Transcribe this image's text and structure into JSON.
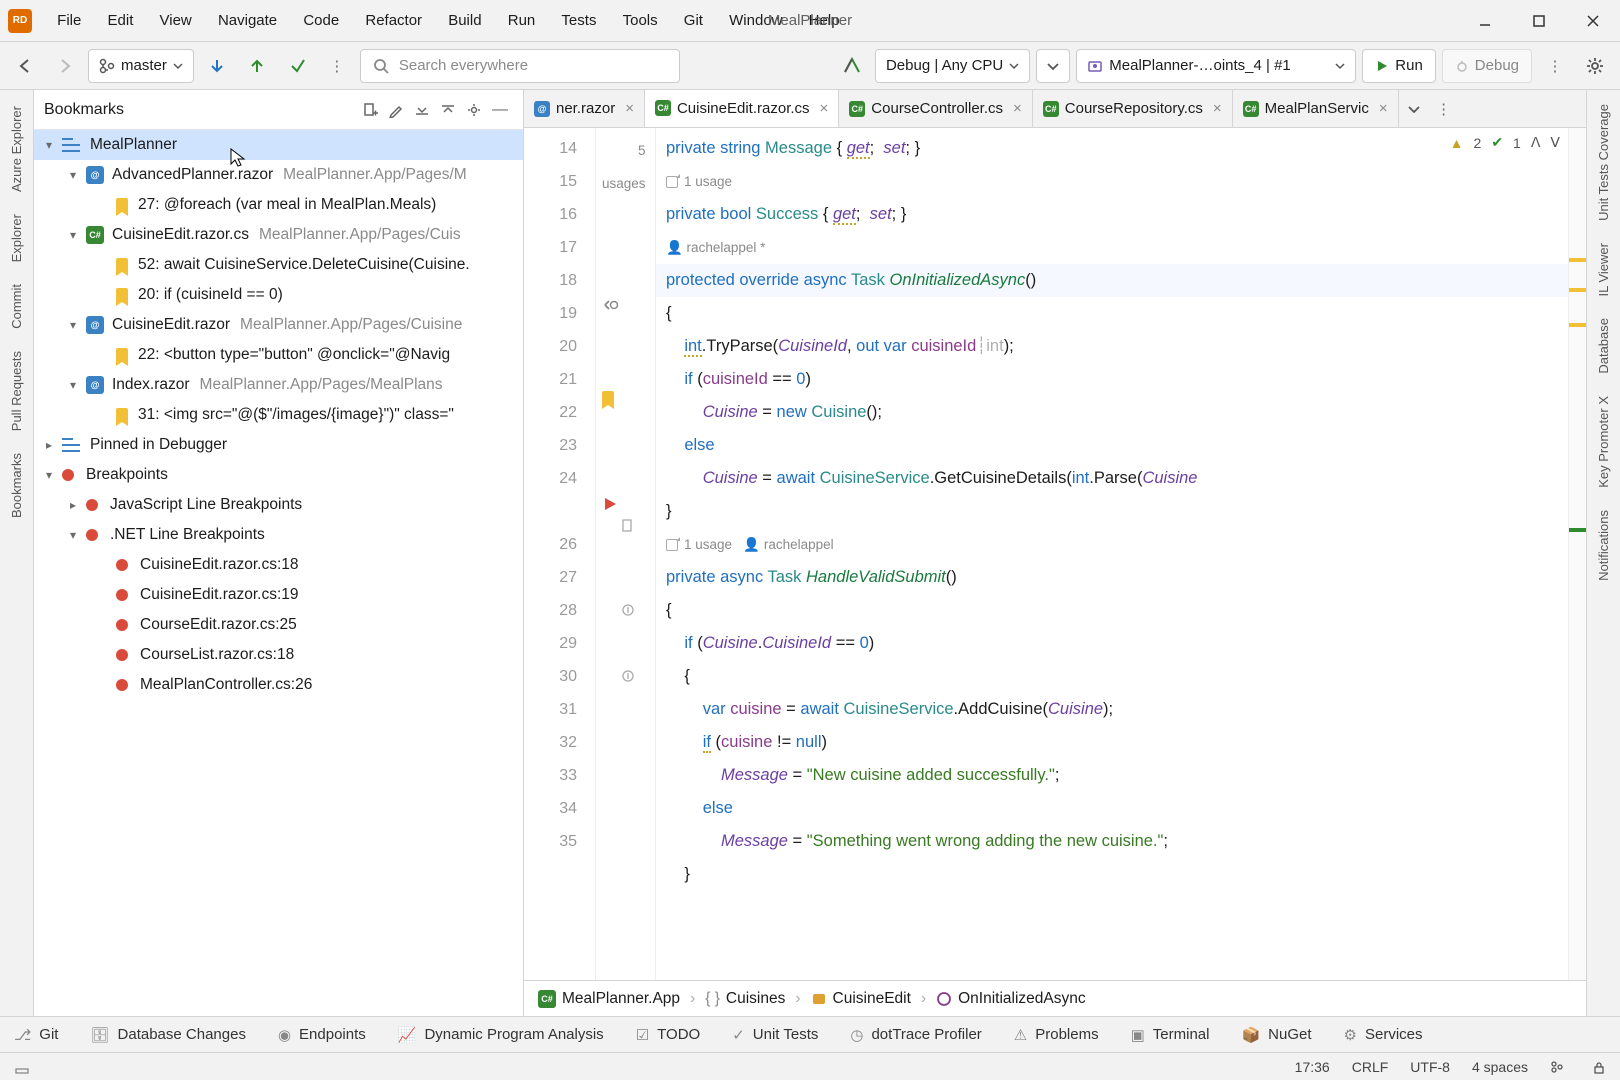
{
  "app": {
    "title": "MealPlanner"
  },
  "menu": [
    "File",
    "Edit",
    "View",
    "Navigate",
    "Code",
    "Refactor",
    "Build",
    "Run",
    "Tests",
    "Tools",
    "Git",
    "Window",
    "Help"
  ],
  "toolbar": {
    "branch": "master",
    "search_placeholder": "Search everywhere",
    "debug_cfg": "Debug | Any CPU",
    "run_cfg": "MealPlanner-…oints_4 | #1",
    "run_label": "Run",
    "debug_label": "Debug"
  },
  "left_rail": [
    "Azure Explorer",
    "Explorer",
    "Commit",
    "Pull Requests",
    "Bookmarks"
  ],
  "right_rail": [
    "Unit Tests Coverage",
    "IL Viewer",
    "Database",
    "Key Promoter X",
    "Notifications"
  ],
  "panel": {
    "title": "Bookmarks",
    "root": "MealPlanner",
    "files": [
      {
        "name": "AdvancedPlanner.razor",
        "path": "MealPlanner.App/Pages/M",
        "kind": "rz",
        "bm": [
          {
            "line": "27",
            "text": "@foreach (var meal in MealPlan.Meals)"
          }
        ]
      },
      {
        "name": "CuisineEdit.razor.cs",
        "path": "MealPlanner.App/Pages/Cuis",
        "kind": "cs",
        "bm": [
          {
            "line": "52",
            "text": "await CuisineService.DeleteCuisine(Cuisine."
          },
          {
            "line": "20",
            "text": "if (cuisineId == 0)"
          }
        ]
      },
      {
        "name": "CuisineEdit.razor",
        "path": "MealPlanner.App/Pages/Cuisine",
        "kind": "rz",
        "bm": [
          {
            "line": "22",
            "text": "<button type=\"button\" @onclick=\"@Navig"
          }
        ]
      },
      {
        "name": "Index.razor",
        "path": "MealPlanner.App/Pages/MealPlans",
        "kind": "rz",
        "bm": [
          {
            "line": "31",
            "text": "<img src=\"@($\"/images/{image}\")\" class=\""
          }
        ]
      }
    ],
    "pinned": "Pinned in Debugger",
    "breakpoints_label": "Breakpoints",
    "bp_groups": [
      {
        "name": "JavaScript Line Breakpoints",
        "expanded": false,
        "items": []
      },
      {
        "name": ".NET Line Breakpoints",
        "expanded": true,
        "items": [
          "CuisineEdit.razor.cs:18",
          "CuisineEdit.razor.cs:19",
          "CourseEdit.razor.cs:25",
          "CourseList.razor.cs:18",
          "MealPlanController.cs:26"
        ]
      }
    ]
  },
  "tabs": [
    {
      "label": "ner.razor",
      "kind": "rz",
      "active": false,
      "trunc": true
    },
    {
      "label": "CuisineEdit.razor.cs",
      "kind": "cs",
      "active": true
    },
    {
      "label": "CourseController.cs",
      "kind": "cs",
      "active": false
    },
    {
      "label": "CourseRepository.cs",
      "kind": "cs",
      "active": false
    },
    {
      "label": "MealPlanServic",
      "kind": "cs",
      "active": false,
      "trunc": true
    }
  ],
  "editor_status": {
    "warn": "2",
    "ok": "1"
  },
  "gutter_lines": [
    "14",
    "15",
    "16",
    "17",
    "18",
    "19",
    "20",
    "21",
    "22",
    "23",
    "24",
    "",
    "26",
    "27",
    "28",
    "29",
    "30",
    "31",
    "32",
    "33",
    "34",
    "35"
  ],
  "annotations": {
    "usages_top": "5 usages",
    "usage1": "1 usage",
    "author1": "rachelappel *",
    "usage2": "1 usage",
    "author2": "rachelappel"
  },
  "code_lines": [
    {
      "seg": [
        [
          "kw",
          "private "
        ],
        [
          "kw",
          "string "
        ],
        [
          "ty",
          "Message"
        ],
        [
          "",
          " { "
        ],
        [
          "prop under",
          "get"
        ],
        [
          "",
          ";  "
        ],
        [
          "prop",
          "set"
        ],
        [
          "",
          "; }"
        ]
      ]
    },
    {
      "usage": "usage1"
    },
    {
      "seg": [
        [
          "kw",
          "private "
        ],
        [
          "kw",
          "bool "
        ],
        [
          "ty",
          "Success"
        ],
        [
          "",
          " { "
        ],
        [
          "prop under",
          "get"
        ],
        [
          "",
          ";  "
        ],
        [
          "prop",
          "set"
        ],
        [
          "",
          "; }"
        ]
      ]
    },
    {
      "seg": [
        [
          "",
          ""
        ]
      ]
    },
    {
      "author": "author1"
    },
    {
      "seg": [
        [
          "kw",
          "protected override async "
        ],
        [
          "ty",
          "Task "
        ],
        [
          "fn",
          "OnInitializedAsync"
        ],
        [
          "",
          "()"
        ]
      ],
      "hl": true
    },
    {
      "seg": [
        [
          "",
          "{"
        ]
      ]
    },
    {
      "seg": [
        [
          "",
          "    "
        ],
        [
          "kw under",
          "int"
        ],
        [
          "",
          ".TryParse("
        ],
        [
          "prop",
          "CuisineId"
        ],
        [
          "",
          ", "
        ],
        [
          "kw",
          "out var "
        ],
        [
          "var",
          "cuisineId"
        ],
        [
          "hint",
          "┆int"
        ],
        [
          "",
          ");"
        ]
      ]
    },
    {
      "seg": [
        [
          "",
          "    "
        ],
        [
          "kw",
          "if "
        ],
        [
          "",
          "("
        ],
        [
          "var",
          "cuisineId"
        ],
        [
          "",
          " == "
        ],
        [
          "num",
          "0"
        ],
        [
          "",
          ")"
        ]
      ]
    },
    {
      "seg": [
        [
          "",
          "        "
        ],
        [
          "prop",
          "Cuisine"
        ],
        [
          "",
          " = "
        ],
        [
          "kw",
          "new "
        ],
        [
          "ty",
          "Cuisine"
        ],
        [
          "",
          "();"
        ]
      ]
    },
    {
      "seg": [
        [
          "",
          "    "
        ],
        [
          "kw",
          "else"
        ]
      ]
    },
    {
      "seg": [
        [
          "",
          "        "
        ],
        [
          "prop",
          "Cuisine"
        ],
        [
          "",
          " = "
        ],
        [
          "kw",
          "await "
        ],
        [
          "ty",
          "CuisineService"
        ],
        [
          "",
          ".GetCuisineDetails("
        ],
        [
          "kw",
          "int"
        ],
        [
          "",
          ".Parse("
        ],
        [
          "prop",
          "Cuisine"
        ]
      ]
    },
    {
      "seg": [
        [
          "",
          "}"
        ]
      ]
    },
    {
      "seg": [
        [
          "",
          ""
        ]
      ]
    },
    {
      "usage_author": true
    },
    {
      "seg": [
        [
          "kw",
          "private async "
        ],
        [
          "ty",
          "Task "
        ],
        [
          "fn",
          "HandleValidSubmit"
        ],
        [
          "",
          "()"
        ]
      ]
    },
    {
      "seg": [
        [
          "",
          "{"
        ]
      ]
    },
    {
      "seg": [
        [
          "",
          "    "
        ],
        [
          "kw",
          "if "
        ],
        [
          "",
          "("
        ],
        [
          "prop",
          "Cuisine"
        ],
        [
          "",
          "."
        ],
        [
          "prop",
          "CuisineId"
        ],
        [
          "",
          " == "
        ],
        [
          "num",
          "0"
        ],
        [
          "",
          ")"
        ]
      ]
    },
    {
      "seg": [
        [
          "",
          "    {"
        ]
      ]
    },
    {
      "seg": [
        [
          "",
          "        "
        ],
        [
          "kw",
          "var "
        ],
        [
          "var",
          "cuisine"
        ],
        [
          "",
          " = "
        ],
        [
          "kw",
          "await "
        ],
        [
          "ty",
          "CuisineService"
        ],
        [
          "",
          ".AddCuisine("
        ],
        [
          "prop",
          "Cuisine"
        ],
        [
          "",
          ");"
        ]
      ]
    },
    {
      "seg": [
        [
          "",
          "        "
        ],
        [
          "kw under",
          "if"
        ],
        [
          "",
          " ("
        ],
        [
          "var",
          "cuisine"
        ],
        [
          "",
          " != "
        ],
        [
          "kw",
          "null"
        ],
        [
          "",
          ")"
        ]
      ]
    },
    {
      "seg": [
        [
          "",
          "            "
        ],
        [
          "prop",
          "Message"
        ],
        [
          "",
          " = "
        ],
        [
          "str",
          "\"New cuisine added successfully.\""
        ],
        [
          "",
          ";"
        ]
      ]
    },
    {
      "seg": [
        [
          "",
          "        "
        ],
        [
          "kw",
          "else"
        ]
      ]
    },
    {
      "seg": [
        [
          "",
          "            "
        ],
        [
          "prop",
          "Message"
        ],
        [
          "",
          " = "
        ],
        [
          "str",
          "\"Something went wrong adding the new cuisine.\""
        ],
        [
          "",
          ";"
        ]
      ]
    },
    {
      "seg": [
        [
          "",
          "    }"
        ]
      ]
    }
  ],
  "breadcrumb": [
    "MealPlanner.App",
    "Cuisines",
    "CuisineEdit",
    "OnInitializedAsync"
  ],
  "bottom": [
    "Git",
    "Database Changes",
    "Endpoints",
    "Dynamic Program Analysis",
    "TODO",
    "Unit Tests",
    "dotTrace Profiler",
    "Problems",
    "Terminal",
    "NuGet",
    "Services"
  ],
  "status": {
    "time": "17:36",
    "le": "CRLF",
    "enc": "UTF-8",
    "indent": "4 spaces"
  }
}
